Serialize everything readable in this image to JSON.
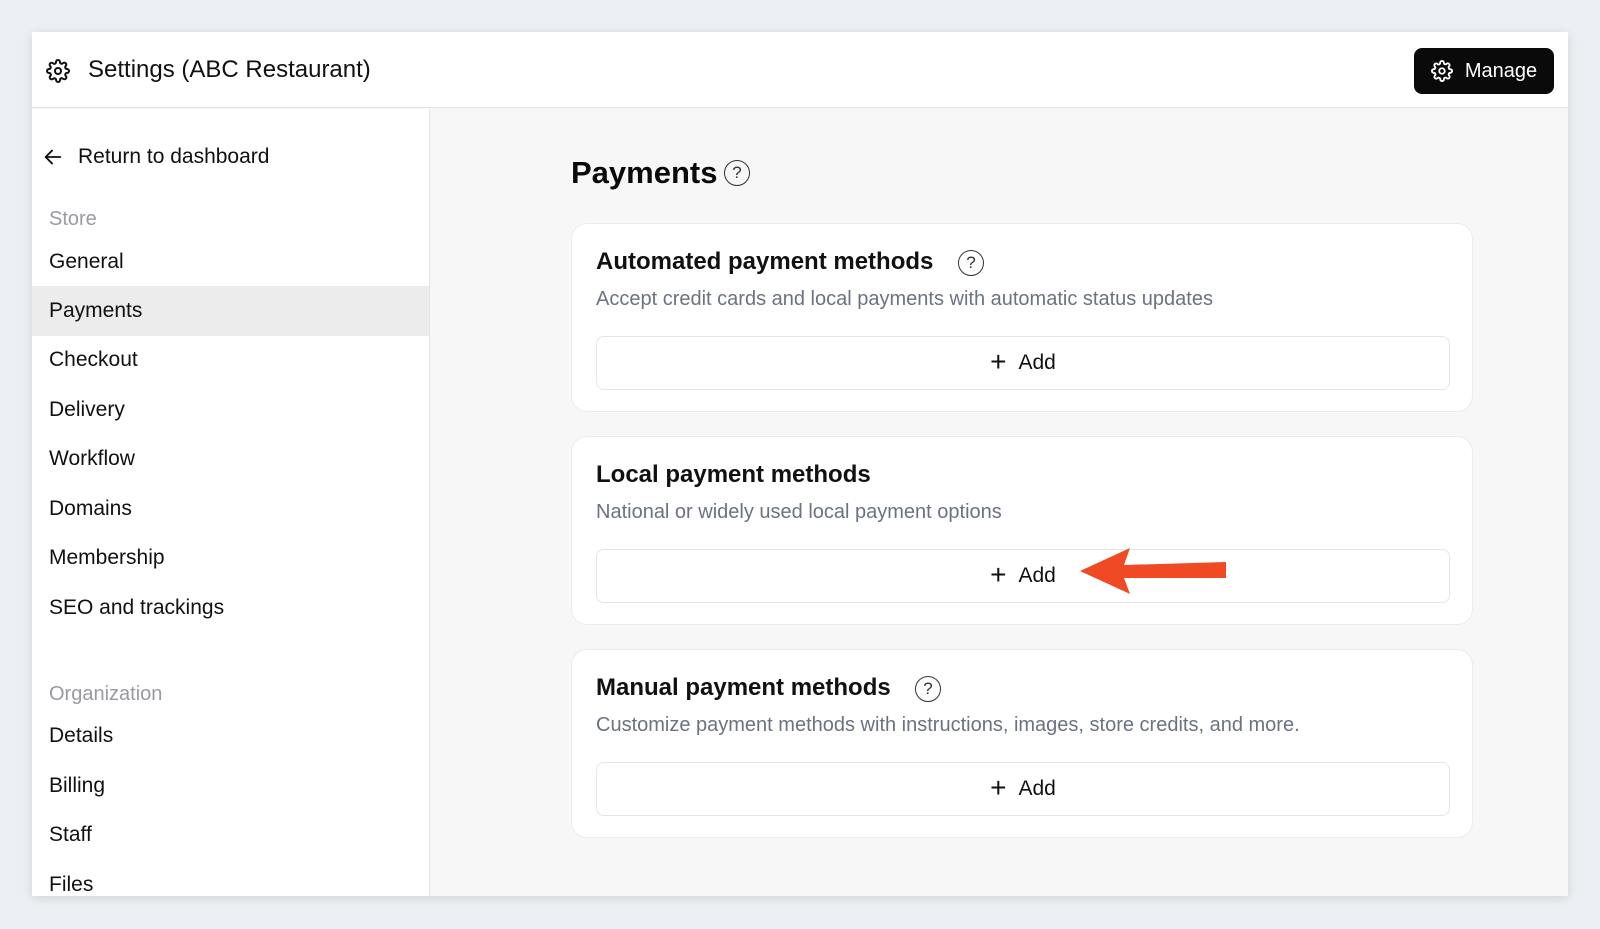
{
  "header": {
    "title": "Settings (ABC Restaurant)",
    "manage_label": "Manage"
  },
  "sidebar": {
    "return_label": "Return to dashboard",
    "store_label": "Store",
    "store_items": [
      {
        "label": "General"
      },
      {
        "label": "Payments",
        "active": true
      },
      {
        "label": "Checkout"
      },
      {
        "label": "Delivery"
      },
      {
        "label": "Workflow"
      },
      {
        "label": "Domains"
      },
      {
        "label": "Membership"
      },
      {
        "label": "SEO and trackings"
      }
    ],
    "org_label": "Organization",
    "org_items": [
      {
        "label": "Details"
      },
      {
        "label": "Billing"
      },
      {
        "label": "Staff"
      },
      {
        "label": "Files"
      }
    ]
  },
  "main": {
    "title": "Payments",
    "help_glyph": "?",
    "sections": [
      {
        "title": "Automated payment methods",
        "description": "Accept credit cards and local payments with automatic status updates",
        "add_label": "Add",
        "has_help": true
      },
      {
        "title": "Local payment methods",
        "description": "National or widely used local payment options",
        "add_label": "Add",
        "has_help": false
      },
      {
        "title": "Manual payment methods",
        "description": "Customize payment methods with instructions, images, store credits, and more.",
        "add_label": "Add",
        "has_help": true
      }
    ]
  },
  "icons": {
    "settings": "gear-icon",
    "back": "arrow-left-icon",
    "help": "question-circle-icon",
    "add": "plus-icon"
  },
  "colors": {
    "accent_arrow": "#f04a24",
    "manage_bg": "#0a0a0a",
    "active_nav_bg": "#ececed"
  }
}
